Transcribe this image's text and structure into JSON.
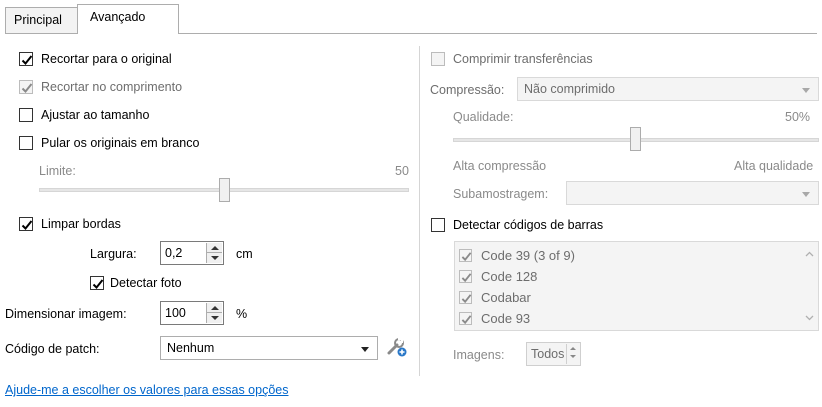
{
  "tabs": [
    {
      "label": "Principal"
    },
    {
      "label": "Avançado"
    }
  ],
  "left": {
    "crop_original": "Recortar para o original",
    "crop_length": "Recortar no comprimento",
    "fit_size": "Ajustar ao tamanho",
    "skip_blank": "Pular os originais em branco",
    "limit_label": "Limite:",
    "limit_value": "50",
    "limit_slider": 0.5,
    "clean_edges": "Limpar bordas",
    "width_label": "Largura:",
    "width_value": "0,2",
    "width_unit": "cm",
    "detect_photo": "Detectar foto",
    "scale_label": "Dimensionar imagem:",
    "scale_value": "100",
    "scale_unit": "%",
    "patch_label": "Código de patch:",
    "patch_value": "Nenhum",
    "help_link": "Ajude-me a escolher os valores para essas opções"
  },
  "right": {
    "compress_transfers": "Comprimir transferências",
    "compression_label": "Compressão:",
    "compression_value": "Não comprimido",
    "quality_label": "Qualidade:",
    "quality_value": "50%",
    "quality_slider": 0.5,
    "high_compression": "Alta compressão",
    "high_quality": "Alta qualidade",
    "subsampling_label": "Subamostragem:",
    "subsampling_value": "",
    "detect_barcodes": "Detectar códigos de barras",
    "barcodes": [
      {
        "label": "Code 39 (3 of 9)"
      },
      {
        "label": "Code 128"
      },
      {
        "label": "Codabar"
      },
      {
        "label": "Code 93"
      }
    ],
    "images_label": "Imagens:",
    "images_value": "Todos"
  },
  "icons": {
    "patch_tool": "wrench-plus-icon",
    "check": "check-icon"
  },
  "colors": {
    "link": "#0066cc",
    "disabled_text": "#6d6d6d"
  }
}
